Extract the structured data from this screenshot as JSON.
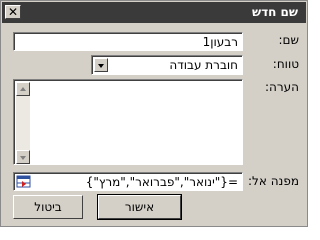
{
  "window": {
    "title": "שם חדש",
    "close_icon": "✕"
  },
  "name": {
    "label": "שם:",
    "value": "רבעון1"
  },
  "scope": {
    "label": "טווח:",
    "value": "חוברת עבודה"
  },
  "comment": {
    "label": "הערה:",
    "value": ""
  },
  "refers_to": {
    "label": "מפנה אל:",
    "value": "={\"ינואר\",\"פברואר\",\"מרץ\"}"
  },
  "buttons": {
    "ok": "אישור",
    "cancel": "ביטול"
  }
}
